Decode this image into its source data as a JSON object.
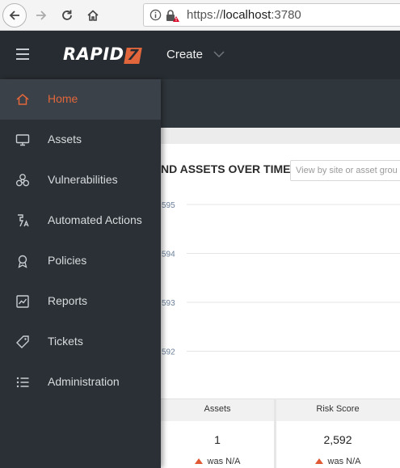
{
  "browser": {
    "url_prefix": "https://",
    "url_host": "localhost",
    "url_port": ":3780"
  },
  "header": {
    "logo_text": "RAPID",
    "logo_mark": "7",
    "create_label": "Create"
  },
  "sidebar": {
    "items": [
      {
        "label": "Home",
        "icon": "home-icon",
        "active": true
      },
      {
        "label": "Assets",
        "icon": "monitor-icon"
      },
      {
        "label": "Vulnerabilities",
        "icon": "biohazard-icon"
      },
      {
        "label": "Automated Actions",
        "icon": "automation-icon"
      },
      {
        "label": "Policies",
        "icon": "ribbon-icon"
      },
      {
        "label": "Reports",
        "icon": "chart-report-icon"
      },
      {
        "label": "Tickets",
        "icon": "ticket-icon"
      },
      {
        "label": "Administration",
        "icon": "list-icon"
      }
    ]
  },
  "card": {
    "title": "ND ASSETS OVER TIME",
    "select_placeholder": "View by site or asset grou",
    "chart_data": {
      "type": "line",
      "y_tick_labels": [
        "595",
        "594",
        "593",
        "592"
      ],
      "grid": true
    }
  },
  "stats": [
    {
      "label": "Assets",
      "value": "1",
      "change": "was N/A"
    },
    {
      "label": "Risk Score",
      "value": "2,592",
      "change": "was N/A"
    }
  ],
  "colors": {
    "accent": "#e1663b",
    "header_bg": "#262c31",
    "sidebar_bg": "#2a3036"
  }
}
